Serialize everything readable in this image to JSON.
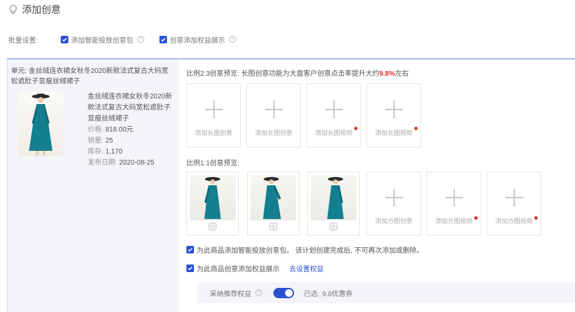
{
  "header": {
    "title": "添加创意",
    "icon": "lightbulb-icon"
  },
  "batch": {
    "label": "批量设置:",
    "option1": "添加智能投放创意包",
    "option2": "创意添加权益展示"
  },
  "unit": {
    "title": "单元: 金丝绒连衣裙女秋冬2020新款法式复古大码宽松遮肚子显瘦丝绒裙子",
    "product_name": "金丝绒连衣裙女秋冬2020新款法式复古大码宽松遮肚子显瘦丝绒裙子",
    "price_label": "价格:",
    "price": "818.00元",
    "sales_label": "销量:",
    "sales": "25",
    "stock_label": "库存:",
    "stock": "1,170",
    "date_label": "发布日期:",
    "date": "2020-08-25"
  },
  "ratio23": {
    "label_prefix": "比例2:3创意预览: 长图创意功能为大盘客户创意点击率提升大约",
    "percent": "9.8%",
    "label_suffix": "左右",
    "tiles": [
      "添加长图创意",
      "添加长图创意",
      "添加长图视频",
      "添加长图视频"
    ]
  },
  "ratio11": {
    "label": "比例1:1创意预览:",
    "tiles": [
      "添加方图创意",
      "添加方图视频",
      "添加方图视频"
    ]
  },
  "options": {
    "smart_pkg": "为此商品添加智能投放创意包。 该计划创建完成后, 不可再次添加或删除。",
    "rights": "为此商品创意添加权益展示",
    "rights_link": "去设置权益"
  },
  "rights_bar": {
    "label": "采纳推荐权益",
    "selected_label": "已选:",
    "selected_value": "9.8优惠券"
  },
  "colors": {
    "accent": "#2b50d4",
    "highlight": "#e0332a"
  }
}
